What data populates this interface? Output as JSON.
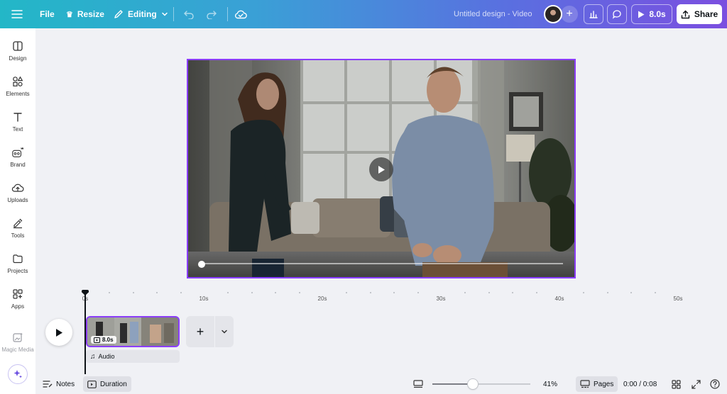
{
  "topbar": {
    "file": "File",
    "resize": "Resize",
    "mode": "Editing",
    "doc_title": "Untitled design - Video",
    "play_duration": "8.0s",
    "share": "Share"
  },
  "sidebar": {
    "items": [
      {
        "label": "Design",
        "icon": "design-icon"
      },
      {
        "label": "Elements",
        "icon": "elements-icon"
      },
      {
        "label": "Text",
        "icon": "text-icon"
      },
      {
        "label": "Brand",
        "icon": "brand-icon"
      },
      {
        "label": "Uploads",
        "icon": "uploads-icon"
      },
      {
        "label": "Tools",
        "icon": "tools-icon"
      },
      {
        "label": "Projects",
        "icon": "projects-icon"
      },
      {
        "label": "Apps",
        "icon": "apps-icon"
      },
      {
        "label": "Magic Media",
        "icon": "magic-media-icon"
      }
    ]
  },
  "canvas": {
    "playback_progress": 0.0
  },
  "timeline": {
    "ticks": [
      "0s",
      "10s",
      "20s",
      "30s",
      "40s",
      "50s"
    ],
    "clip_duration": "8.0s",
    "audio_label": "Audio"
  },
  "footer": {
    "notes": "Notes",
    "duration": "Duration",
    "zoom_percent": "41%",
    "zoom_value": 0.41,
    "pages": "Pages",
    "time": "0:00 / 0:08"
  },
  "colors": {
    "accent": "#8b3dff",
    "topbar_start": "#23b7c7",
    "topbar_end": "#7b4fe0"
  }
}
